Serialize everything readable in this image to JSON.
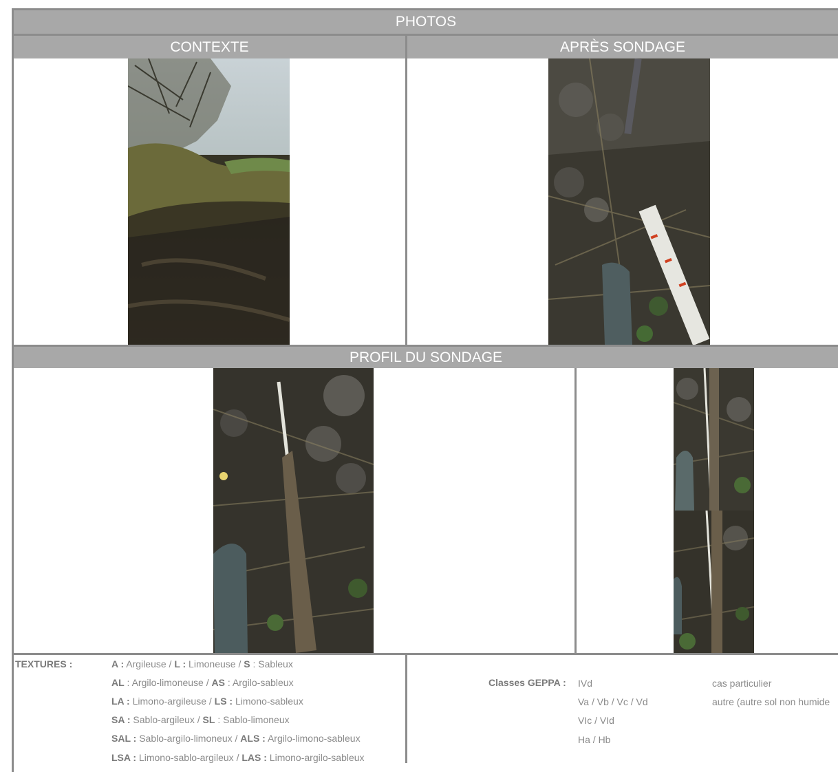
{
  "header": {
    "title": "PHOTOS"
  },
  "sections": {
    "contexte": "CONTEXTE",
    "apres_sondage": "APRÈS SONDAGE",
    "profil": "PROFIL DU SONDAGE"
  },
  "photos": {
    "contexte": "context-landscape-photo",
    "apres": "post-sounding-ground-photo",
    "profil_main": "sounding-profile-photo",
    "profil_top": "sounding-profile-detail-upper",
    "profil_bottom": "sounding-profile-detail-lower"
  },
  "textures": {
    "label": "TEXTURES :",
    "lines": [
      [
        {
          "b": "A :"
        },
        {
          "t": " Argileuse / "
        },
        {
          "b": "L :"
        },
        {
          "t": " Limoneuse / "
        },
        {
          "b": "S"
        },
        {
          "t": " : Sableux"
        }
      ],
      [
        {
          "b": "AL"
        },
        {
          "t": " : Argilo-limoneuse / "
        },
        {
          "b": "AS"
        },
        {
          "t": " : Argilo-sableux"
        }
      ],
      [
        {
          "b": "LA :"
        },
        {
          "t": " Limono-argileuse / "
        },
        {
          "b": "LS :"
        },
        {
          "t": " Limono-sableux"
        }
      ],
      [
        {
          "b": "SA :"
        },
        {
          "t": " Sablo-argileux / "
        },
        {
          "b": "SL"
        },
        {
          "t": " : Sablo-limoneux"
        }
      ],
      [
        {
          "b": "SAL :"
        },
        {
          "t": " Sablo-argilo-limoneux  / "
        },
        {
          "b": "ALS :"
        },
        {
          "t": " Argilo-limono-sableux"
        }
      ],
      [
        {
          "b": "LSA :"
        },
        {
          "t": " Limono-sablo-argileux /  "
        },
        {
          "b": "LAS :"
        },
        {
          "t": " Limono-argilo-sableux"
        }
      ]
    ]
  },
  "geppa": {
    "label": "Classes GEPPA :",
    "classes": [
      "IVd",
      "Va / Vb / Vc / Vd",
      "VIc / VId",
      "Ha / Hb"
    ],
    "notes": [
      "cas particulier",
      "autre (autre sol non humide"
    ]
  },
  "colors": {
    "bar": "#a8a8a8",
    "border": "#8c8c8c",
    "text": "#8a8a8a"
  }
}
